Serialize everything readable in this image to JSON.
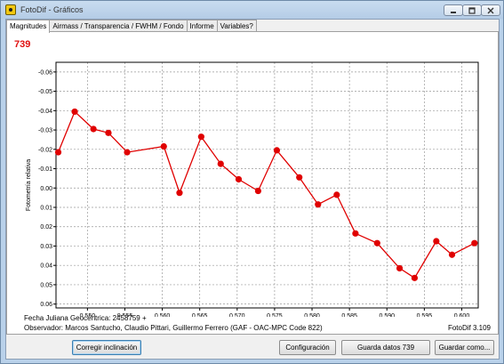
{
  "window": {
    "title": "FotoDif - Gráficos"
  },
  "tabs": [
    {
      "label": "Magnitudes"
    },
    {
      "label": "Airmass / Transparencia / FWHM / Fondo"
    },
    {
      "label": "Informe"
    },
    {
      "label": "Variables?"
    }
  ],
  "panel": {
    "star_id": "739",
    "julian_date_label": "Fecha Juliana Geocéntrica: 2458759 +",
    "observer_label": "Observador: Marcos Santucho, Claudio Pittari, Guillermo Ferrero (GAF - OAC-MPC Code 822)",
    "version": "FotoDif 3.109"
  },
  "buttons": {
    "correct_tilt": "Corregir inclinación",
    "configuration": "Configuración",
    "save_data": "Guarda datos 739",
    "save_as": "Guardar como..."
  },
  "colors": {
    "series": "#e00000",
    "highlight_id": "#e01010"
  },
  "chart_data": {
    "type": "line",
    "title": "",
    "xlabel": "",
    "ylabel": "Fotometría relativa",
    "y_inverted": true,
    "xlim": [
      0.5458,
      0.6022
    ],
    "ylim": [
      -0.065,
      0.062
    ],
    "x_ticks": [
      0.55,
      0.555,
      0.56,
      0.565,
      0.57,
      0.575,
      0.58,
      0.585,
      0.59,
      0.595,
      0.6
    ],
    "x_tick_labels": [
      "0.550",
      "0.555",
      "0.560",
      "0.565",
      "0.570",
      "0.575",
      "0.580",
      "0.585",
      "0.590",
      "0.595",
      "0.600"
    ],
    "y_ticks": [
      -0.06,
      -0.05,
      -0.04,
      -0.03,
      -0.02,
      -0.01,
      0.0,
      0.01,
      0.02,
      0.03,
      0.04,
      0.05,
      0.06
    ],
    "y_tick_labels": [
      "-0.06",
      "-0.05",
      "-0.04",
      "-0.03",
      "-0.02",
      "-0.01",
      "0.00",
      "0.01",
      "0.02",
      "0.03",
      "0.04",
      "0.05",
      "0.06"
    ],
    "grid": true,
    "series": [
      {
        "x": [
          0.5461,
          0.5483,
          0.5508,
          0.5528,
          0.5553,
          0.5602,
          0.5623,
          0.5652,
          0.5678,
          0.5702,
          0.5728,
          0.5753,
          0.5783,
          0.5808,
          0.5833,
          0.5858,
          0.5887,
          0.5917,
          0.5937,
          0.5966,
          0.5987,
          0.6017
        ],
        "y": [
          -0.0185,
          -0.0395,
          -0.0305,
          -0.0285,
          -0.0185,
          -0.0215,
          0.0025,
          -0.0265,
          -0.0125,
          -0.0045,
          0.0015,
          -0.0195,
          -0.0055,
          0.0085,
          0.0035,
          0.0235,
          0.0285,
          0.0415,
          0.0465,
          0.0275,
          0.0345,
          0.0285
        ]
      }
    ]
  }
}
